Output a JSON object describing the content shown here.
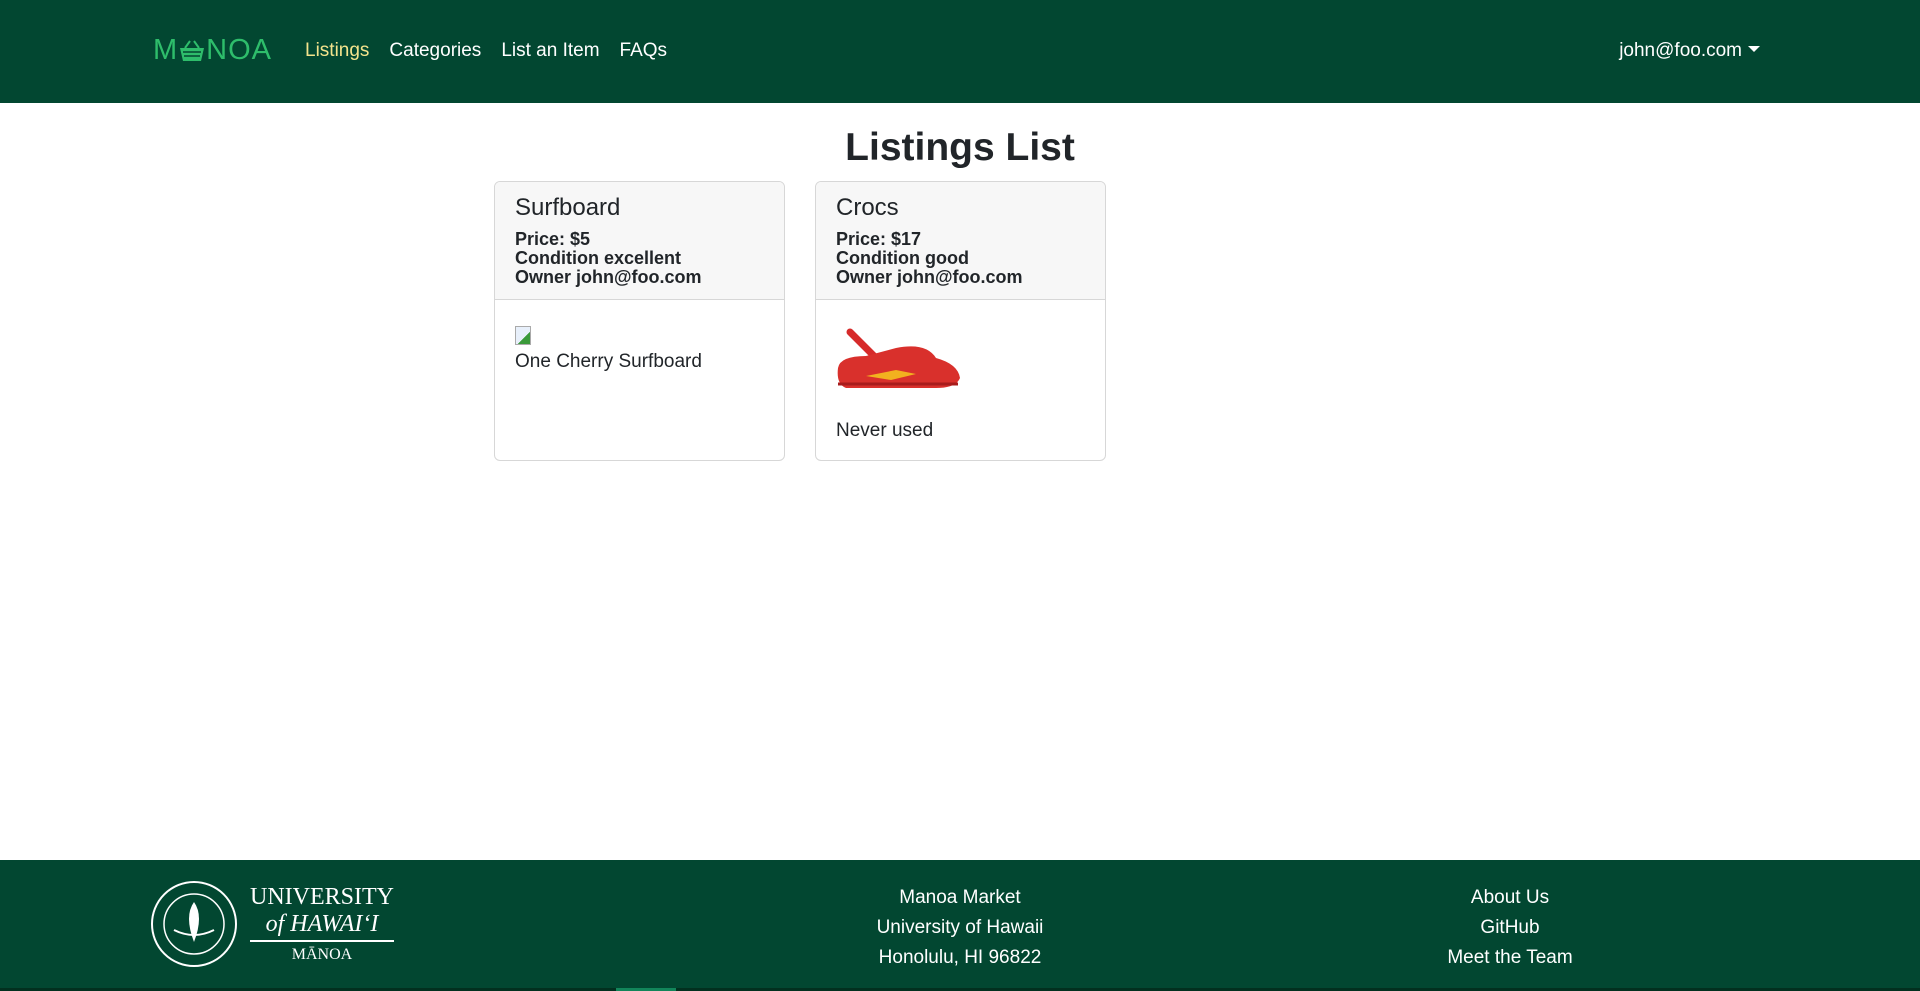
{
  "navbar": {
    "brand": {
      "left": "M",
      "right": "NOA"
    },
    "links": [
      {
        "label": "Listings",
        "active": true
      },
      {
        "label": "Categories"
      },
      {
        "label": "List an Item"
      },
      {
        "label": "FAQs"
      }
    ],
    "user": "john@foo.com"
  },
  "page": {
    "title": "Listings List"
  },
  "listings": [
    {
      "name": "Surfboard",
      "price": "Price: $5",
      "condition": "Condition excellent",
      "owner": "Owner john@foo.com",
      "image": "broken-image",
      "description": "One Cherry Surfboard"
    },
    {
      "name": "Crocs",
      "price": "Price: $17",
      "condition": "Condition good",
      "owner": "Owner john@foo.com",
      "image": "red-crocs-shoe",
      "description": "Never used"
    }
  ],
  "footer": {
    "logo": {
      "line1": "UNIVERSITY",
      "line2": "of HAWAI‘I",
      "line3": "MĀNOA"
    },
    "center": [
      "Manoa Market",
      "University of Hawaii",
      "Honolulu, HI 96822"
    ],
    "right": [
      "About Us",
      "GitHub",
      "Meet the Team"
    ]
  },
  "colors": {
    "navbar": "#024731",
    "brand": "#2ebd6b",
    "active_link": "#f3e38c"
  }
}
